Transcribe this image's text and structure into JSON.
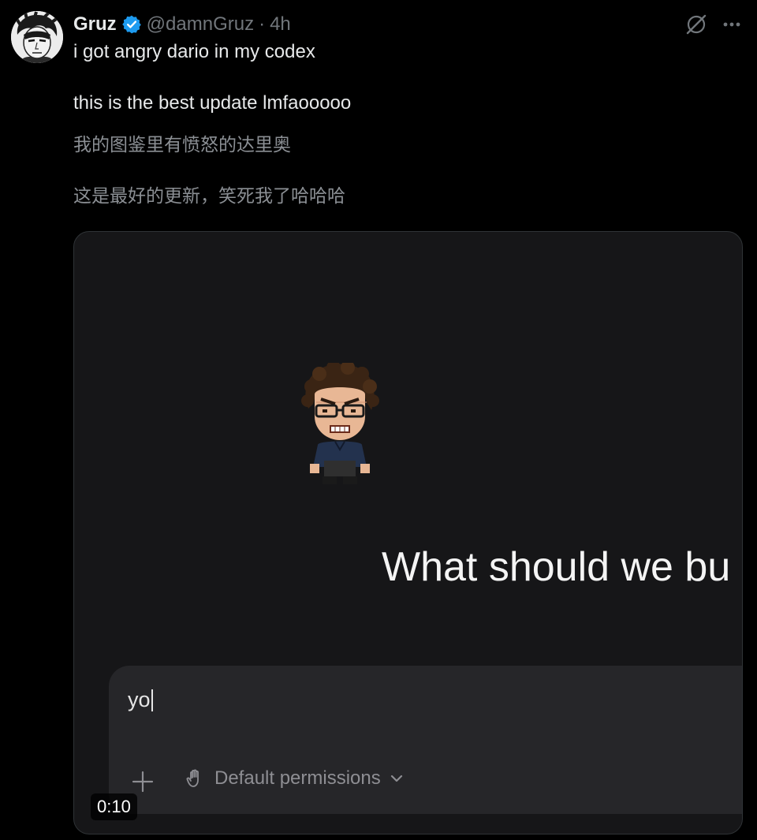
{
  "author": {
    "name": "Gruz",
    "handle": "@damnGruz",
    "separator": "·",
    "time": "4h"
  },
  "tweet": {
    "lines": [
      "i got angry dario in my codex",
      "this is the best update lmfaooooo",
      "我的图鉴里有愤怒的达里奥",
      "这是最好的更新，笑死我了哈哈哈"
    ]
  },
  "media": {
    "headline": "What should we bu",
    "composer": {
      "input_value": "yo",
      "permissions_label": "Default permissions"
    },
    "timestamp": "0:10"
  },
  "icons": {
    "verified": "verified-badge-icon",
    "grok": "grok-icon",
    "more": "more-icon",
    "plus": "plus-icon",
    "hand": "hand-icon",
    "chevron": "chevron-down-icon"
  },
  "colors": {
    "background": "#000000",
    "verified_blue": "#1d9bf0",
    "muted_text": "#71767b",
    "media_bg": "#161618",
    "composer_bg": "#262629"
  }
}
